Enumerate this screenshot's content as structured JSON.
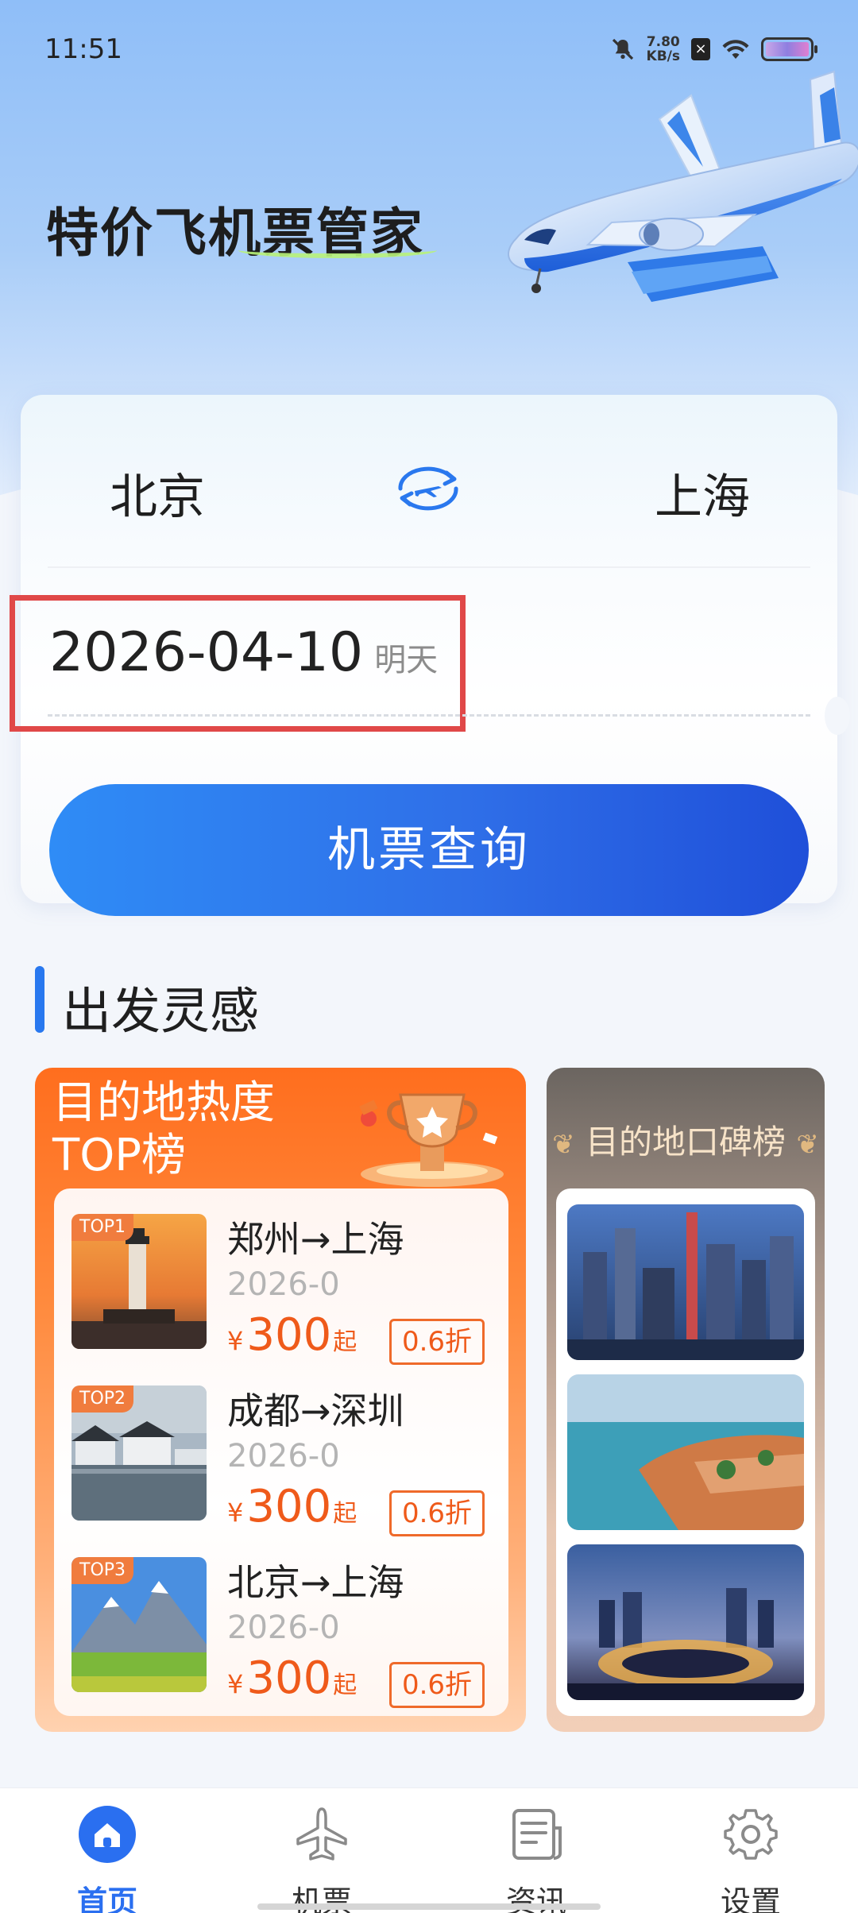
{
  "status_bar": {
    "time": "11:51",
    "speed_value": "7.80",
    "speed_unit": "KB/s"
  },
  "header": {
    "title": "特价飞机票管家"
  },
  "search": {
    "from_city": "北京",
    "to_city": "上海",
    "date": "2026-04-10",
    "date_tag": "明天",
    "search_button": "机票查询"
  },
  "inspiration": {
    "section_title": "出发灵感",
    "hot_card": {
      "title_line1": "目的地热度",
      "title_line2": "TOP榜",
      "items": [
        {
          "badge": "TOP1",
          "route": "郑州→上海",
          "date": "2026-0",
          "currency": "¥",
          "price": "300",
          "suffix": "起",
          "discount": "0.6折"
        },
        {
          "badge": "TOP2",
          "route": "成都→深圳",
          "date": "2026-0",
          "currency": "¥",
          "price": "300",
          "suffix": "起",
          "discount": "0.6折"
        },
        {
          "badge": "TOP3",
          "route": "北京→上海",
          "date": "2026-0",
          "currency": "¥",
          "price": "300",
          "suffix": "起",
          "discount": "0.6折"
        }
      ]
    },
    "review_card": {
      "title": "目的地口碑榜"
    }
  },
  "bottom_nav": {
    "items": [
      {
        "label": "首页",
        "icon": "home-icon",
        "active": true
      },
      {
        "label": "机票",
        "icon": "airplane-icon",
        "active": false
      },
      {
        "label": "资讯",
        "icon": "news-icon",
        "active": false
      },
      {
        "label": "设置",
        "icon": "gear-icon",
        "active": false
      }
    ]
  },
  "colors": {
    "primary": "#2a6ff0",
    "accent_orange": "#ef5a1a",
    "highlight_red": "#e04848"
  }
}
